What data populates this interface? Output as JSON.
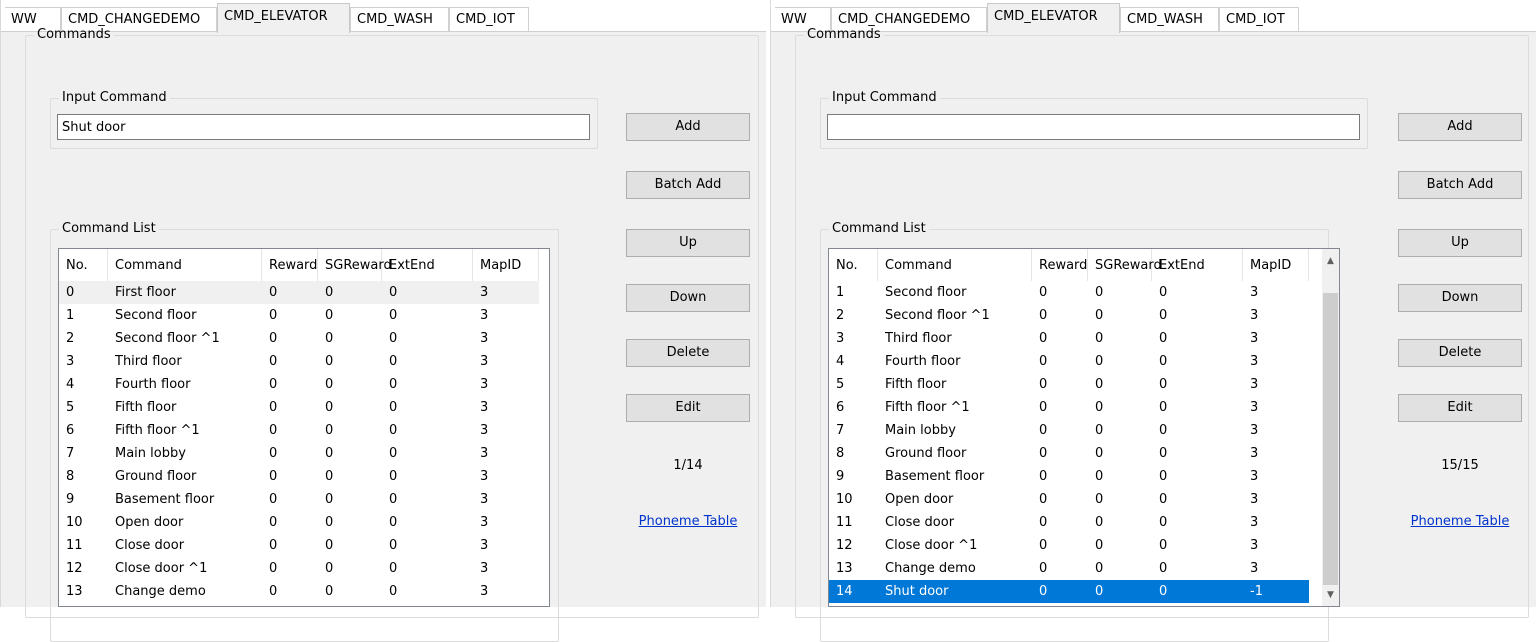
{
  "tabs": [
    "WW",
    "CMD_CHANGEDEMO",
    "CMD_ELEVATOR",
    "CMD_WASH",
    "CMD_IOT"
  ],
  "active_tab": "CMD_ELEVATOR",
  "labels": {
    "commands_group": "Commands",
    "input_group": "Input Command",
    "list_group": "Command List",
    "phoneme_link": "Phoneme Table"
  },
  "buttons": {
    "add": "Add",
    "batch_add": "Batch Add",
    "up": "Up",
    "down": "Down",
    "delete": "Delete",
    "edit": "Edit"
  },
  "columns": [
    "No.",
    "Command",
    "Reward",
    "SGReward",
    "ExtEnd",
    "MapID"
  ],
  "left": {
    "input_value": "Shut door",
    "counter": "1/14",
    "rows": [
      [
        "0",
        "First floor",
        "0",
        "0",
        "0",
        "3"
      ],
      [
        "1",
        "Second floor",
        "0",
        "0",
        "0",
        "3"
      ],
      [
        "2",
        "Second floor ^1",
        "0",
        "0",
        "0",
        "3"
      ],
      [
        "3",
        "Third floor",
        "0",
        "0",
        "0",
        "3"
      ],
      [
        "4",
        "Fourth floor",
        "0",
        "0",
        "0",
        "3"
      ],
      [
        "5",
        "Fifth floor",
        "0",
        "0",
        "0",
        "3"
      ],
      [
        "6",
        "Fifth floor ^1",
        "0",
        "0",
        "0",
        "3"
      ],
      [
        "7",
        "Main lobby",
        "0",
        "0",
        "0",
        "3"
      ],
      [
        "8",
        "Ground floor",
        "0",
        "0",
        "0",
        "3"
      ],
      [
        "9",
        "Basement floor",
        "0",
        "0",
        "0",
        "3"
      ],
      [
        "10",
        "Open door",
        "0",
        "0",
        "0",
        "3"
      ],
      [
        "11",
        "Close door",
        "0",
        "0",
        "0",
        "3"
      ],
      [
        "12",
        "Close door ^1",
        "0",
        "0",
        "0",
        "3"
      ],
      [
        "13",
        "Change demo",
        "0",
        "0",
        "0",
        "3"
      ]
    ],
    "highlighted_row": 0
  },
  "right": {
    "input_value": "",
    "counter": "15/15",
    "rows": [
      [
        "1",
        "Second floor",
        "0",
        "0",
        "0",
        "3"
      ],
      [
        "2",
        "Second floor ^1",
        "0",
        "0",
        "0",
        "3"
      ],
      [
        "3",
        "Third floor",
        "0",
        "0",
        "0",
        "3"
      ],
      [
        "4",
        "Fourth floor",
        "0",
        "0",
        "0",
        "3"
      ],
      [
        "5",
        "Fifth floor",
        "0",
        "0",
        "0",
        "3"
      ],
      [
        "6",
        "Fifth floor ^1",
        "0",
        "0",
        "0",
        "3"
      ],
      [
        "7",
        "Main lobby",
        "0",
        "0",
        "0",
        "3"
      ],
      [
        "8",
        "Ground floor",
        "0",
        "0",
        "0",
        "3"
      ],
      [
        "9",
        "Basement floor",
        "0",
        "0",
        "0",
        "3"
      ],
      [
        "10",
        "Open door",
        "0",
        "0",
        "0",
        "3"
      ],
      [
        "11",
        "Close door",
        "0",
        "0",
        "0",
        "3"
      ],
      [
        "12",
        "Close door ^1",
        "0",
        "0",
        "0",
        "3"
      ],
      [
        "13",
        "Change demo",
        "0",
        "0",
        "0",
        "3"
      ],
      [
        "14",
        "Shut door",
        "0",
        "0",
        "0",
        "-1"
      ]
    ],
    "selected_row": 13
  },
  "colors": {
    "selection": "#0078d7",
    "link": "#0033cc",
    "panel_bg": "#f0f0f0"
  }
}
